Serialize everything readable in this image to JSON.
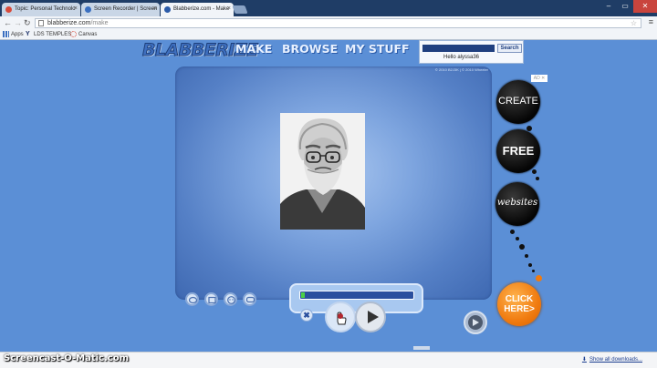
{
  "browser": {
    "tabs": [
      {
        "title": "Topic: Personal Technolo",
        "favicon_color": "#d84a3a"
      },
      {
        "title": "Screen Recorder | Screen",
        "favicon_color": "#3a6fc0"
      },
      {
        "title": "Blabberize.com - Make",
        "favicon_color": "#2a5aa8"
      }
    ],
    "address": {
      "host": "blabberize.com",
      "path": "/make"
    },
    "bookmarks": [
      {
        "label": "Apps",
        "icon": "apps-grid-icon"
      },
      {
        "label": "LDS TEMPLES",
        "icon": "byu-y-icon"
      },
      {
        "label": "Canvas",
        "icon": "canvas-logo-icon"
      }
    ]
  },
  "site": {
    "logo": "BLABBERIZE",
    "nav": [
      "MAKE",
      "BROWSE",
      "MY STUFF"
    ],
    "search_button": "Search",
    "greeting": "Hello alyssa36",
    "copyright": "© 2010 B2J3K | © 2010 Wheeler"
  },
  "player": {
    "progress_fraction": 0.03,
    "close_label": "✖"
  },
  "ad": {
    "label": "AD ✕",
    "bubbles": [
      "CREATE",
      "FREE",
      "websites"
    ],
    "cta": "CLICK HERE>"
  },
  "footer": {
    "watermark": "Screencast-O-Matic.com",
    "show_downloads": "Show all downloads..."
  },
  "colors": {
    "accent": "#5b8fd6",
    "cta": "#f07b10",
    "progress": "#4cd146"
  }
}
